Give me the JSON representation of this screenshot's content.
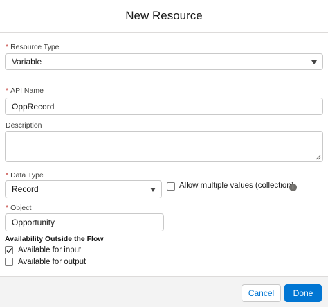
{
  "modal": {
    "title": "New Resource"
  },
  "resource_type": {
    "required": "*",
    "label": "Resource Type",
    "value": "Variable"
  },
  "api_name": {
    "required": "*",
    "label": "API Name",
    "value": "OppRecord"
  },
  "description": {
    "label": "Description",
    "value": ""
  },
  "data_type": {
    "required": "*",
    "label": "Data Type",
    "value": "Record",
    "allow_multiple_label": "Allow multiple values (collection)",
    "allow_multiple_checked": false
  },
  "object": {
    "required": "*",
    "label": "Object",
    "value": "Opportunity"
  },
  "availability": {
    "title": "Availability Outside the Flow",
    "input_label": "Available for input",
    "input_checked": true,
    "output_label": "Available for output",
    "output_checked": false
  },
  "footer": {
    "cancel_label": "Cancel",
    "done_label": "Done"
  },
  "colors": {
    "brand": "#0176d3",
    "required": "#c23934",
    "border": "#c9c9c9",
    "footer_bg": "#f3f3f3"
  },
  "icons": {
    "dropdown": "chevron-down-icon",
    "info": "info-icon",
    "check": "check-icon",
    "resize": "resize-handle-icon"
  }
}
